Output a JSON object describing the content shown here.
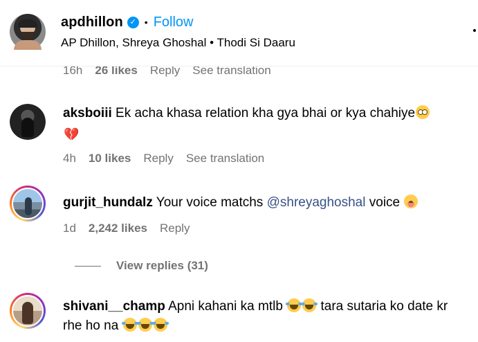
{
  "header": {
    "username": "apdhillon",
    "verified_icon": "verified-badge-icon",
    "separator": "•",
    "follow_label": "Follow",
    "subline": "AP Dhillon, Shreya Ghoshal • Thodi Si Daaru"
  },
  "partial_comment": {
    "time": "16h",
    "likes": "26 likes",
    "reply": "Reply",
    "translation": "See translation"
  },
  "comments": [
    {
      "username": "aksboiii",
      "text_1": "Ek acha khasa relation kha gya bhai or kya chahiye",
      "emoji_1": "flushed-face-emoji",
      "emoji_2": "broken-heart-emoji",
      "time": "4h",
      "likes": "10 likes",
      "reply": "Reply",
      "translation": "See translation"
    },
    {
      "username": "gurjit_hundalz",
      "text_before": "Your voice matchs",
      "mention": "@shreyaghoshal",
      "text_after": "voice",
      "emoji_1": "astonished-face-emoji",
      "time": "1d",
      "likes": "2,242 likes",
      "reply": "Reply",
      "view_replies": "View replies (31)"
    },
    {
      "username": "shivani__champ",
      "text_1": "Apni kahani ka mtlb",
      "text_2": "tara sutaria ko date kr rhe ho na",
      "emoji": "face-with-tears-of-joy-emoji"
    }
  ]
}
